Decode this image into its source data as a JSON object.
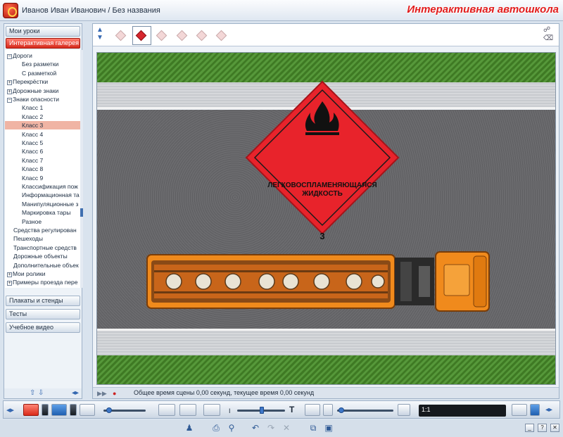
{
  "window": {
    "title": "Иванов Иван Иванович / Без названия",
    "brand": "Интерактивная автошкола"
  },
  "sidebar": {
    "buttons": [
      {
        "label": "Мои уроки"
      },
      {
        "label": "Интерактивная галерея"
      }
    ],
    "bottom_buttons": [
      {
        "label": "Плакаты и стенды"
      },
      {
        "label": "Тесты"
      },
      {
        "label": "Учебное видео"
      }
    ],
    "tree": [
      {
        "label": "Дороги",
        "indent": 0,
        "expander": "⊟"
      },
      {
        "label": "Без разметки",
        "indent": 2
      },
      {
        "label": "С разметкой",
        "indent": 2
      },
      {
        "label": "Перекрёстки",
        "indent": 0,
        "expander": "⊞"
      },
      {
        "label": "Дорожные знаки",
        "indent": 0,
        "expander": "⊞"
      },
      {
        "label": "Знаки опасности",
        "indent": 0,
        "expander": "⊟"
      },
      {
        "label": "Класс 1",
        "indent": 2
      },
      {
        "label": "Класс 2",
        "indent": 2
      },
      {
        "label": "Класс 3",
        "indent": 2,
        "selected": true
      },
      {
        "label": "Класс 4",
        "indent": 2
      },
      {
        "label": "Класс 5",
        "indent": 2
      },
      {
        "label": "Класс 6",
        "indent": 2
      },
      {
        "label": "Класс 7",
        "indent": 2
      },
      {
        "label": "Класс 8",
        "indent": 2
      },
      {
        "label": "Класс 9",
        "indent": 2
      },
      {
        "label": "Классификация пож",
        "indent": 2
      },
      {
        "label": "Информационная та",
        "indent": 2
      },
      {
        "label": "Манипуляционные з",
        "indent": 2
      },
      {
        "label": "Маркировка тары",
        "indent": 2
      },
      {
        "label": "Разное",
        "indent": 2
      },
      {
        "label": "Средства регулирован",
        "indent": 1
      },
      {
        "label": "Пешеходы",
        "indent": 1
      },
      {
        "label": "Транспортные средств",
        "indent": 1
      },
      {
        "label": "Дорожные объекты",
        "indent": 1
      },
      {
        "label": "Дополнительные объек",
        "indent": 1
      },
      {
        "label": "Мои ролики",
        "indent": 0,
        "expander": "⊞"
      },
      {
        "label": "Примеры проезда пере",
        "indent": 0,
        "expander": "⊞"
      }
    ]
  },
  "scene": {
    "placard_text_line1": "ЛЕГКОВОСПЛАМЕНЯЮЩАЯСЯ",
    "placard_text_line2": "ЖИДКОСТЬ",
    "placard_class": "3",
    "colors": {
      "placard": "#e8232b",
      "truck": "#f08a1c",
      "grass": "#4a8a2e",
      "asphalt": "#656568"
    }
  },
  "status": {
    "text": "Общее время сцены 0,00 секунд, текущее время 0,00 секунд"
  },
  "playback": {
    "time_label": "1:1"
  }
}
